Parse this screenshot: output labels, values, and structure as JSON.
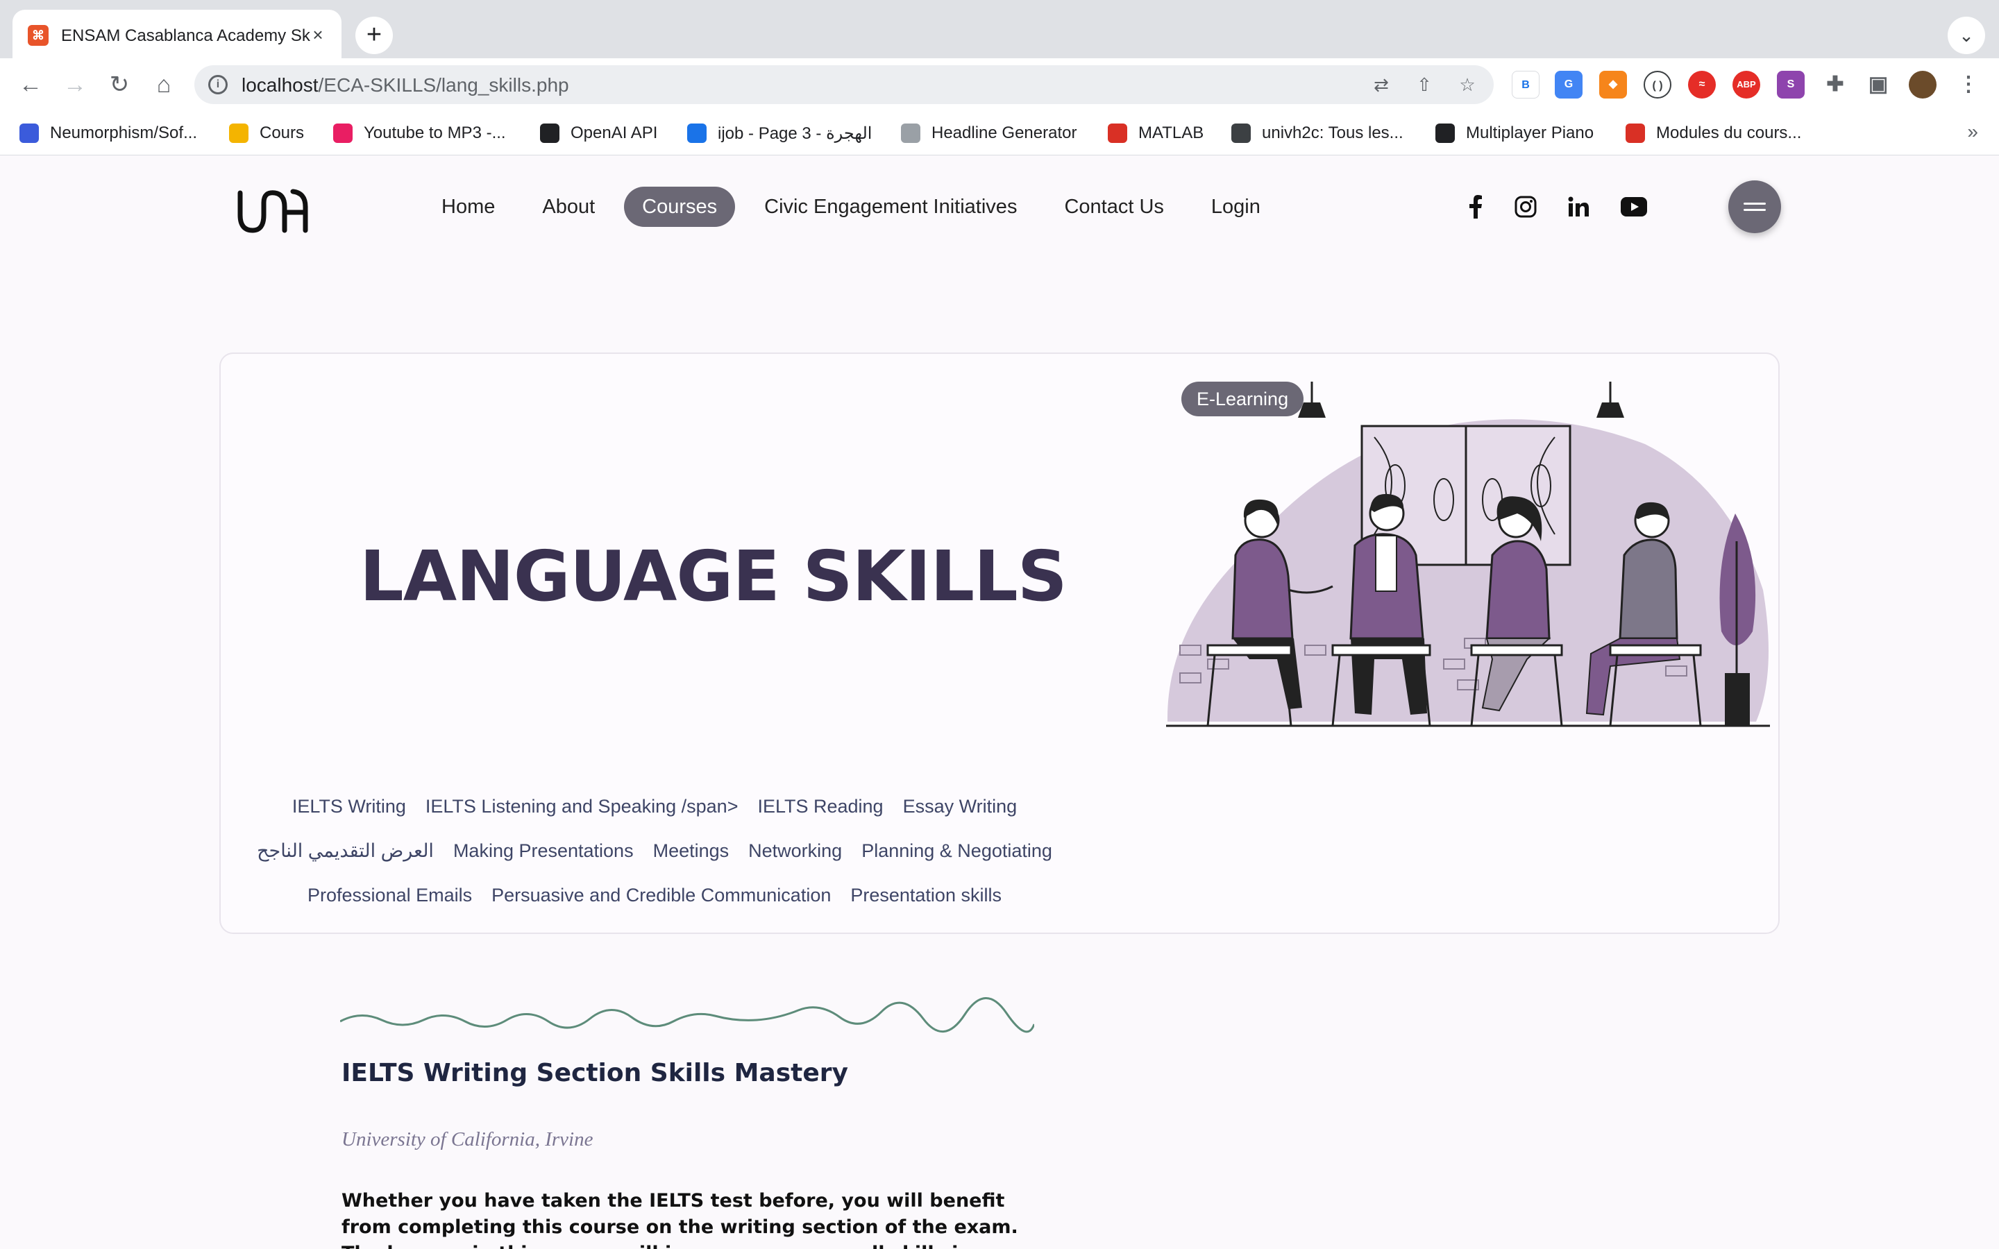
{
  "browser": {
    "tab_title": "ENSAM Casablanca Academy Skills",
    "tab_close": "×",
    "new_tab": "+",
    "url_host": "localhost",
    "url_path": "/ECA-SKILLS/lang_skills.php",
    "bookmarks": [
      {
        "label": "Neumorphism/Sof...",
        "color": "#3b5bdb"
      },
      {
        "label": "Cours",
        "color": "#f4b400"
      },
      {
        "label": "Youtube to MP3 -...",
        "color": "#e91e63"
      },
      {
        "label": "OpenAI API",
        "color": "#202124"
      },
      {
        "label": "ijob - Page 3 - الهجرة",
        "color": "#1a73e8"
      },
      {
        "label": "Headline Generator",
        "color": "#9aa0a6"
      },
      {
        "label": "MATLAB",
        "color": "#d93025"
      },
      {
        "label": "univh2c: Tous les...",
        "color": "#3c4043"
      },
      {
        "label": "Multiplayer Piano",
        "color": "#202124"
      },
      {
        "label": "Modules du cours...",
        "color": "#d93025"
      }
    ],
    "bookmarks_more": "»"
  },
  "site": {
    "nav": [
      "Home",
      "About",
      "Courses",
      "Civic Engagement Initiatives",
      "Contact Us",
      "Login"
    ],
    "active_nav": "Courses",
    "accent": "#6b6875",
    "title_color": "#3a3250"
  },
  "hero": {
    "title": "LANGUAGE SKILLS",
    "badge": "E-Learning",
    "links_row1": [
      "IELTS Writing",
      "IELTS Listening and Speaking /span>",
      "IELTS Reading",
      "Essay Writing"
    ],
    "links_row2": [
      "العرض التقديمي الناجح",
      "Making Presentations",
      "Meetings",
      "Networking",
      "Planning & Negotiating"
    ],
    "links_row3": [
      "Professional Emails",
      "Persuasive and Credible Communication",
      "Presentation skills"
    ]
  },
  "course": {
    "title": "IELTS Writing Section Skills Mastery",
    "university": "University of California, Irvine",
    "description": "Whether you have taken the IELTS test before, you will benefit from completing this course on the writing section of the exam. The lessons in this course will improve your overall skills in writing and prepare you for"
  }
}
